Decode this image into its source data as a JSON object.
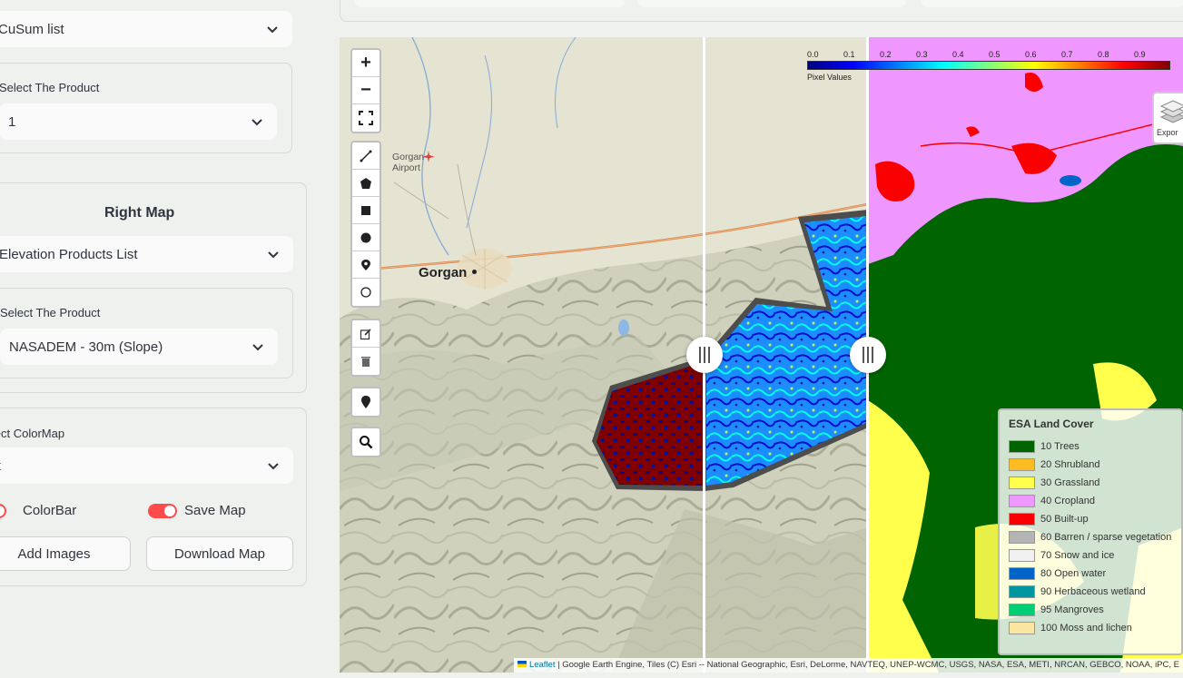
{
  "sidebar": {
    "left_map": {
      "dataset_select": "CuSum list",
      "product_label": "Select The Product",
      "product_value": "1"
    },
    "right_map": {
      "heading": "Right Map",
      "dataset_select": "Elevation Products List",
      "product_label": "Select The Product",
      "product_value": "NASADEM - 30m (Slope)"
    },
    "colormap": {
      "label": "Select ColorMap",
      "value": "jet"
    },
    "toggles": {
      "colorbar_label": "ColorBar",
      "colorbar_on": true,
      "savemap_label": "Save Map",
      "savemap_on": true
    },
    "buttons": {
      "add_images": "Add Images",
      "download_map": "Download Map"
    }
  },
  "map": {
    "zoom_in": "+",
    "zoom_out": "−",
    "places": {
      "airport": "Gorgan Airport",
      "airport_line1": "Gorgan",
      "airport_line2": "Airport",
      "city": "Gorgan"
    },
    "colorbar": {
      "ticks": [
        "0.0",
        "0.1",
        "0.2",
        "0.3",
        "0.4",
        "0.5",
        "0.6",
        "0.7",
        "0.8",
        "0.9"
      ],
      "caption": "Pixel Values",
      "colormap": "jet"
    },
    "layers_control": {
      "label": "Expor"
    },
    "legend": {
      "title": "ESA Land Cover",
      "items": [
        {
          "label": "10 Trees",
          "color": "#006400"
        },
        {
          "label": "20 Shrubland",
          "color": "#ffbb22"
        },
        {
          "label": "30 Grassland",
          "color": "#ffff4c"
        },
        {
          "label": "40 Cropland",
          "color": "#f096ff"
        },
        {
          "label": "50 Built-up",
          "color": "#fa0000"
        },
        {
          "label": "60 Barren / sparse vegetation",
          "color": "#b4b4b4"
        },
        {
          "label": "70 Snow and ice",
          "color": "#f0f0f0"
        },
        {
          "label": "80 Open water",
          "color": "#0064c8"
        },
        {
          "label": "90 Herbaceous wetland",
          "color": "#0096a0"
        },
        {
          "label": "95 Mangroves",
          "color": "#00cf75"
        },
        {
          "label": "100 Moss and lichen",
          "color": "#fae6a0"
        }
      ]
    },
    "attribution": {
      "leaflet": "Leaflet",
      "text": " | Google Earth Engine, Tiles (C) Esri -- National Geographic, Esri, DeLorme, NAVTEQ, UNEP-WCMC, USGS, NASA, ESA, METI, NRCAN, GEBCO, NOAA, iPC, E"
    }
  }
}
